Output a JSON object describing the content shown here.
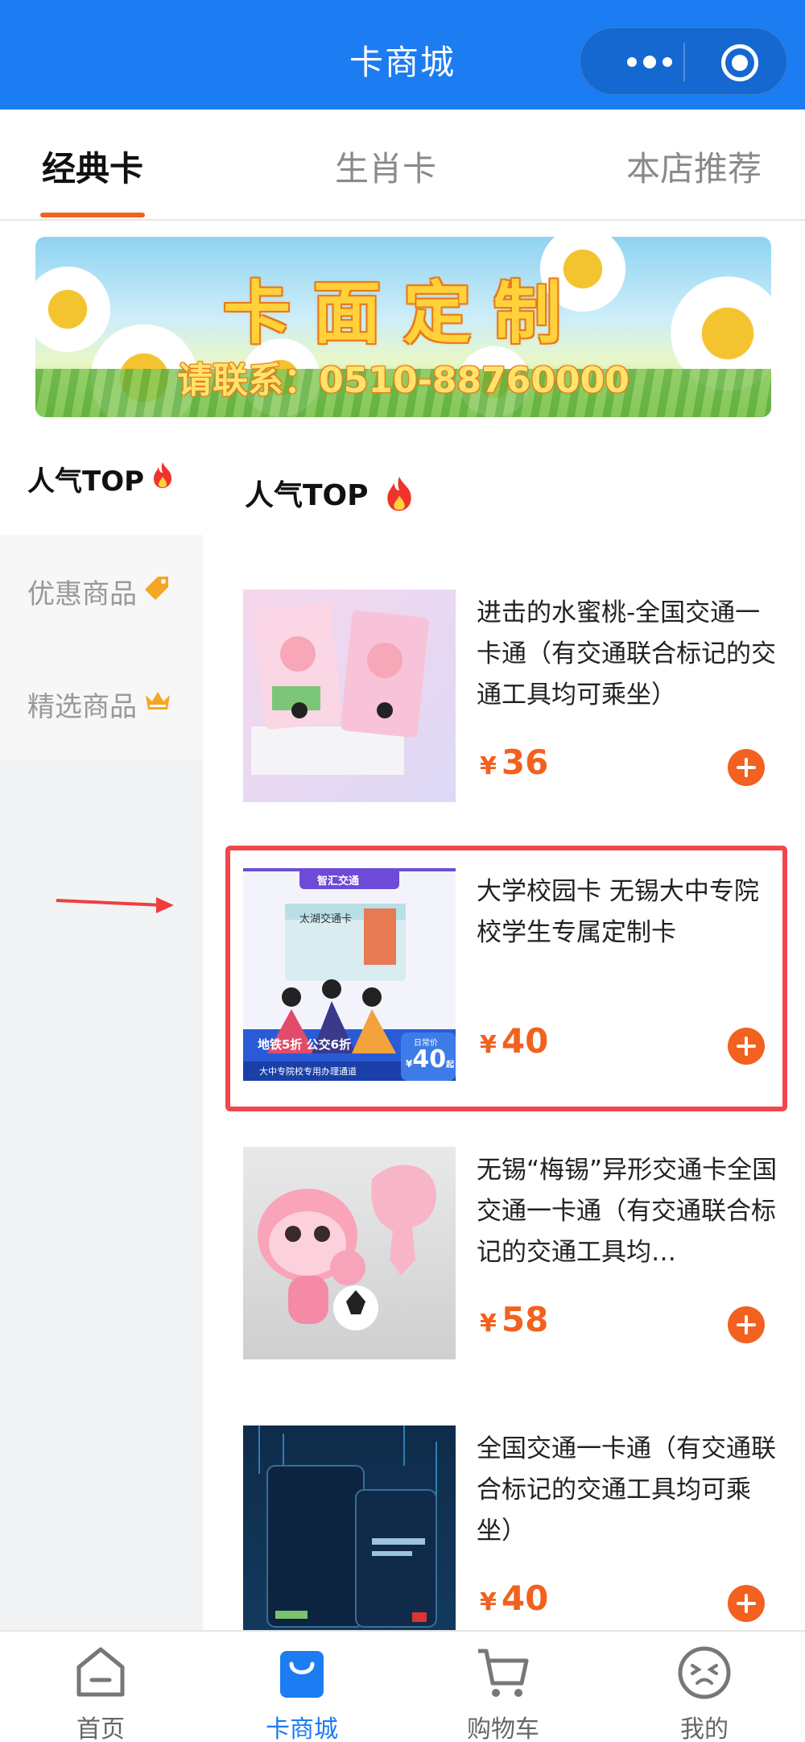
{
  "header": {
    "title": "卡商城"
  },
  "tabs": [
    {
      "label": "经典卡",
      "active": true
    },
    {
      "label": "生肖卡",
      "active": false
    },
    {
      "label": "本店推荐",
      "active": false
    }
  ],
  "banner": {
    "title": "卡面定制",
    "subtitle": "请联系：0510-88760000"
  },
  "sidebar": {
    "items": [
      {
        "label": "人气TOP",
        "icon": "fire-icon",
        "active": true
      },
      {
        "label": "优惠商品",
        "icon": "price-tag-icon",
        "active": false
      },
      {
        "label": "精选商品",
        "icon": "crown-icon",
        "active": false
      }
    ]
  },
  "section": {
    "title": "人气TOP"
  },
  "products": [
    {
      "name": "进击的水蜜桃-全国交通一卡通（有交通联合标记的交通工具均可乘坐）",
      "currency": "¥",
      "price": "36"
    },
    {
      "name": "大学校园卡 无锡大中专院校学生专属定制卡",
      "currency": "¥",
      "price": "40",
      "thumb_texts": {
        "brand": "智汇交通",
        "card": "太湖交通卡",
        "discount": "地铁5折 公交6折",
        "channel": "大中专院校专用办理通道",
        "badge_label": "日常价",
        "badge_price": "40",
        "badge_unit": "起"
      }
    },
    {
      "name": "无锡“梅锡”异形交通卡全国交通一卡通（有交通联合标记的交通工具均…",
      "currency": "¥",
      "price": "58"
    },
    {
      "name": "全国交通一卡通（有交通联合标记的交通工具均可乘坐）",
      "currency": "¥",
      "price": "40"
    }
  ],
  "bottom_nav": [
    {
      "label": "首页",
      "icon": "home-icon",
      "active": false
    },
    {
      "label": "卡商城",
      "icon": "shopping-bag-icon",
      "active": true
    },
    {
      "label": "购物车",
      "icon": "cart-icon",
      "active": false
    },
    {
      "label": "我的",
      "icon": "face-icon",
      "active": false
    }
  ],
  "colors": {
    "primary": "#1c7cf1",
    "accent": "#f2611f",
    "highlight": "#f0474b"
  }
}
